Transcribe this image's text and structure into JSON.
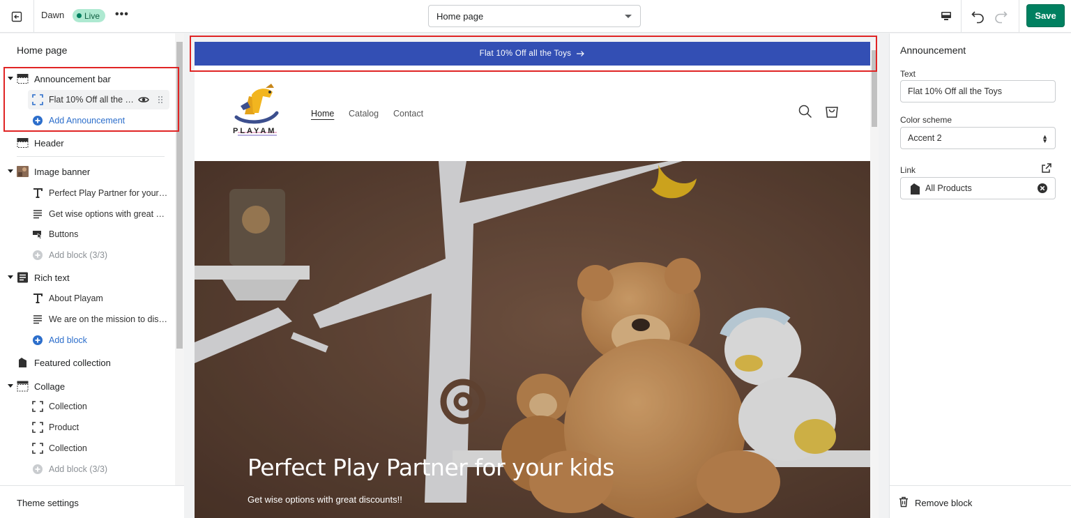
{
  "topbar": {
    "theme_name": "Dawn",
    "live_badge": "Live",
    "more_label": "•••",
    "page_select": "Home page",
    "save_label": "Save"
  },
  "sidebar": {
    "title": "Home page",
    "sections": [
      {
        "label": "Announcement bar",
        "icon": "announcement-bar-icon",
        "expanded": true
      },
      {
        "label": "Header",
        "icon": "header-icon",
        "expanded": false
      },
      {
        "label": "Image banner",
        "icon": "image-banner-icon",
        "expanded": true
      },
      {
        "label": "Rich text",
        "icon": "rich-text-icon",
        "expanded": true
      },
      {
        "label": "Featured collection",
        "icon": "featured-collection-icon",
        "expanded": false
      },
      {
        "label": "Collage",
        "icon": "collage-icon",
        "expanded": true
      }
    ],
    "announcement_blocks": [
      "Flat 10% Off all the T..."
    ],
    "add_announcement": "Add Announcement",
    "image_banner_blocks": [
      "Perfect Play Partner for your k...",
      "Get wise options with great di...",
      "Buttons"
    ],
    "image_banner_add": "Add block (3/3)",
    "rich_text_blocks": [
      "About Playam",
      "We are on the mission to disc..."
    ],
    "rich_text_add": "Add block",
    "collage_blocks": [
      "Collection",
      "Product",
      "Collection"
    ],
    "collage_add": "Add block (3/3)",
    "footer": "Theme settings"
  },
  "preview": {
    "announcement": "Flat 10% Off all the Toys",
    "logo_text": "PLAYAM",
    "nav": [
      "Home",
      "Catalog",
      "Contact"
    ],
    "banner_title": "Perfect Play Partner for your kids",
    "banner_subtitle": "Get wise options with great discounts!!"
  },
  "panel": {
    "title": "Announcement",
    "text_label": "Text",
    "text_value": "Flat 10% Off all the Toys",
    "color_label": "Color scheme",
    "color_value": "Accent 2",
    "link_label": "Link",
    "link_value": "All Products",
    "remove_label": "Remove block"
  },
  "colors": {
    "accent": "#008060",
    "announcement_bg": "#334fb4",
    "highlight": "#e02424",
    "link": "#2c6ecb"
  }
}
